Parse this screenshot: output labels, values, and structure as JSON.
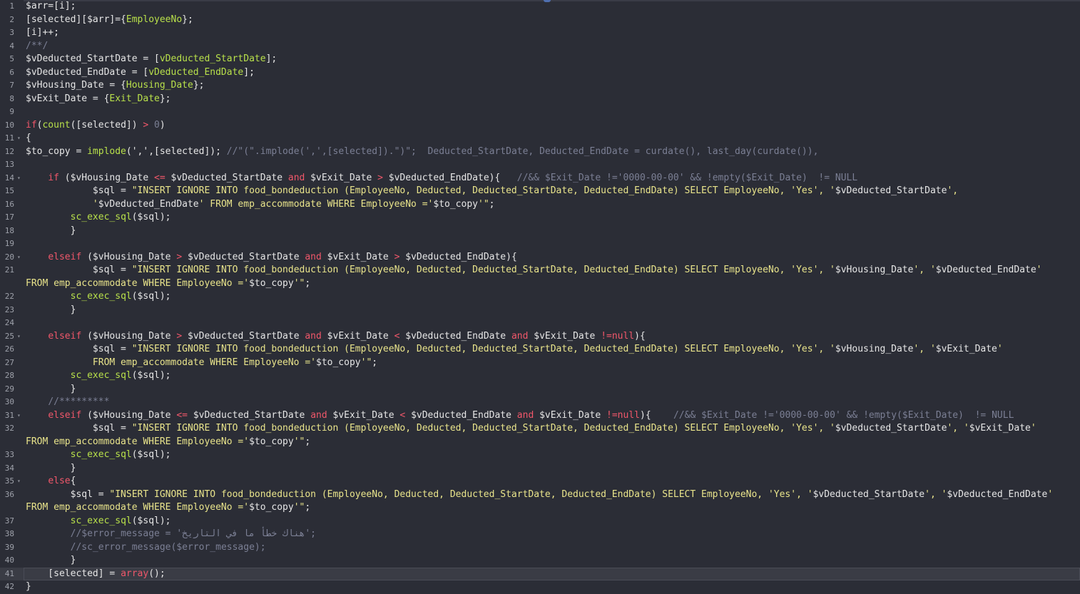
{
  "editor": {
    "lines": [
      {
        "n": "1",
        "segs": [
          [
            "v",
            "$arr="
          ],
          [
            "v",
            "[i]"
          ],
          [
            "v",
            ";"
          ]
        ]
      },
      {
        "n": "2",
        "segs": [
          [
            "v",
            "[selected][$arr]={"
          ],
          [
            "f",
            "EmployeeNo"
          ],
          [
            "v",
            "};"
          ]
        ]
      },
      {
        "n": "3",
        "segs": [
          [
            "v",
            "[i]++;"
          ]
        ]
      },
      {
        "n": "4",
        "segs": [
          [
            "c",
            "/**/"
          ]
        ]
      },
      {
        "n": "5",
        "segs": [
          [
            "v",
            "$vDeducted_StartDate = ["
          ],
          [
            "f",
            "vDeducted_StartDate"
          ],
          [
            "v",
            "];"
          ]
        ]
      },
      {
        "n": "6",
        "segs": [
          [
            "v",
            "$vDeducted_EndDate = ["
          ],
          [
            "f",
            "vDeducted_EndDate"
          ],
          [
            "v",
            "];"
          ]
        ]
      },
      {
        "n": "7",
        "segs": [
          [
            "v",
            "$vHousing_Date = {"
          ],
          [
            "f",
            "Housing_Date"
          ],
          [
            "v",
            "};"
          ]
        ]
      },
      {
        "n": "8",
        "segs": [
          [
            "v",
            "$vExit_Date = {"
          ],
          [
            "f",
            "Exit_Date"
          ],
          [
            "v",
            "};"
          ]
        ]
      },
      {
        "n": "9",
        "segs": []
      },
      {
        "n": "10",
        "segs": [
          [
            "k",
            "if"
          ],
          [
            "v",
            "("
          ],
          [
            "f",
            "count"
          ],
          [
            "v",
            "([selected]) "
          ],
          [
            "k",
            ">"
          ],
          [
            "v",
            " "
          ],
          [
            "c",
            "0"
          ],
          [
            "v",
            ")"
          ]
        ]
      },
      {
        "n": "11",
        "fold": true,
        "segs": [
          [
            "v",
            "{"
          ]
        ]
      },
      {
        "n": "12",
        "segs": [
          [
            "v",
            "$to_copy = "
          ],
          [
            "f",
            "implode"
          ],
          [
            "v",
            "(','"
          ],
          [
            "v",
            ",[selected]); "
          ],
          [
            "c",
            "//\"(\".implode(',',[selected]).\")\";  Deducted_StartDate, Deducted_EndDate = curdate(), last_day(curdate()),"
          ]
        ]
      },
      {
        "n": "13",
        "segs": []
      },
      {
        "n": "14",
        "fold": true,
        "segs": [
          [
            "v",
            "    "
          ],
          [
            "k",
            "if"
          ],
          [
            "v",
            " ($vHousing_Date "
          ],
          [
            "k",
            "<="
          ],
          [
            "v",
            " $vDeducted_StartDate "
          ],
          [
            "k",
            "and"
          ],
          [
            "v",
            " $vExit_Date "
          ],
          [
            "k",
            ">"
          ],
          [
            "v",
            " $vDeducted_EndDate){   "
          ],
          [
            "c",
            "//&& $Exit_Date !='0000-00-00' && !empty($Exit_Date)  != NULL"
          ]
        ]
      },
      {
        "n": "15",
        "segs": [
          [
            "v",
            "            $sql = "
          ],
          [
            "s",
            "\"INSERT IGNORE INTO food_bondeduction (EmployeeNo, Deducted, Deducted_StartDate, Deducted_EndDate) SELECT EmployeeNo, 'Yes', '"
          ],
          [
            "v",
            "$vDeducted_StartDate"
          ],
          [
            "s",
            "',"
          ]
        ]
      },
      {
        "n": "16",
        "segs": [
          [
            "v",
            "            "
          ],
          [
            "s",
            "'"
          ],
          [
            "v",
            "$vDeducted_EndDate"
          ],
          [
            "s",
            "' FROM emp_accommodate WHERE EmployeeNo ='"
          ],
          [
            "v",
            "$to_copy"
          ],
          [
            "s",
            "'\""
          ],
          [
            "v",
            ";"
          ]
        ]
      },
      {
        "n": "17",
        "segs": [
          [
            "v",
            "        "
          ],
          [
            "f",
            "sc_exec_sql"
          ],
          [
            "v",
            "($sql);"
          ]
        ]
      },
      {
        "n": "18",
        "segs": [
          [
            "v",
            "        }"
          ]
        ]
      },
      {
        "n": "19",
        "segs": []
      },
      {
        "n": "20",
        "fold": true,
        "segs": [
          [
            "v",
            "    "
          ],
          [
            "k",
            "elseif"
          ],
          [
            "v",
            " ($vHousing_Date "
          ],
          [
            "k",
            ">"
          ],
          [
            "v",
            " $vDeducted_StartDate "
          ],
          [
            "k",
            "and"
          ],
          [
            "v",
            " $vExit_Date "
          ],
          [
            "k",
            ">"
          ],
          [
            "v",
            " $vDeducted_EndDate){"
          ]
        ]
      },
      {
        "n": "21",
        "segs": [
          [
            "v",
            "            $sql = "
          ],
          [
            "s",
            "\"INSERT IGNORE INTO food_bondeduction (EmployeeNo, Deducted, Deducted_StartDate, Deducted_EndDate) SELECT EmployeeNo, 'Yes', '"
          ],
          [
            "v",
            "$vHousing_Date"
          ],
          [
            "s",
            "', '"
          ],
          [
            "v",
            "$vDeducted_EndDate"
          ],
          [
            "s",
            "'"
          ]
        ]
      },
      {
        "n": "",
        "segs": [
          [
            "s",
            "FROM emp_accommodate WHERE EmployeeNo ='"
          ],
          [
            "v",
            "$to_copy"
          ],
          [
            "s",
            "'\""
          ],
          [
            "v",
            ";"
          ]
        ]
      },
      {
        "n": "22",
        "segs": [
          [
            "v",
            "        "
          ],
          [
            "f",
            "sc_exec_sql"
          ],
          [
            "v",
            "($sql);"
          ]
        ]
      },
      {
        "n": "23",
        "segs": [
          [
            "v",
            "        }"
          ]
        ]
      },
      {
        "n": "24",
        "segs": []
      },
      {
        "n": "25",
        "fold": true,
        "segs": [
          [
            "v",
            "    "
          ],
          [
            "k",
            "elseif"
          ],
          [
            "v",
            " ($vHousing_Date "
          ],
          [
            "k",
            ">"
          ],
          [
            "v",
            " $vDeducted_StartDate "
          ],
          [
            "k",
            "and"
          ],
          [
            "v",
            " $vExit_Date "
          ],
          [
            "k",
            "<"
          ],
          [
            "v",
            " $vDeducted_EndDate "
          ],
          [
            "k",
            "and"
          ],
          [
            "v",
            " $vExit_Date "
          ],
          [
            "k",
            "!=null"
          ],
          [
            "v",
            "){"
          ]
        ]
      },
      {
        "n": "26",
        "segs": [
          [
            "v",
            "            $sql = "
          ],
          [
            "s",
            "\"INSERT IGNORE INTO food_bondeduction (EmployeeNo, Deducted, Deducted_StartDate, Deducted_EndDate) SELECT EmployeeNo, 'Yes', '"
          ],
          [
            "v",
            "$vHousing_Date"
          ],
          [
            "s",
            "', '"
          ],
          [
            "v",
            "$vExit_Date"
          ],
          [
            "s",
            "'"
          ]
        ]
      },
      {
        "n": "27",
        "segs": [
          [
            "s",
            "            FROM emp_accommodate WHERE EmployeeNo ='"
          ],
          [
            "v",
            "$to_copy"
          ],
          [
            "s",
            "'\""
          ],
          [
            "v",
            ";"
          ]
        ]
      },
      {
        "n": "28",
        "segs": [
          [
            "v",
            "        "
          ],
          [
            "f",
            "sc_exec_sql"
          ],
          [
            "v",
            "($sql);"
          ]
        ]
      },
      {
        "n": "29",
        "segs": [
          [
            "v",
            "        }"
          ]
        ]
      },
      {
        "n": "30",
        "segs": [
          [
            "v",
            "    "
          ],
          [
            "c",
            "//*********"
          ]
        ]
      },
      {
        "n": "31",
        "fold": true,
        "segs": [
          [
            "v",
            "    "
          ],
          [
            "k",
            "elseif"
          ],
          [
            "v",
            " ($vHousing_Date "
          ],
          [
            "k",
            "<="
          ],
          [
            "v",
            " $vDeducted_StartDate "
          ],
          [
            "k",
            "and"
          ],
          [
            "v",
            " $vExit_Date "
          ],
          [
            "k",
            "<"
          ],
          [
            "v",
            " $vDeducted_EndDate "
          ],
          [
            "k",
            "and"
          ],
          [
            "v",
            " $vExit_Date "
          ],
          [
            "k",
            "!=null"
          ],
          [
            "v",
            "){    "
          ],
          [
            "c",
            "//&& $Exit_Date !='0000-00-00' && !empty($Exit_Date)  != NULL"
          ]
        ]
      },
      {
        "n": "32",
        "segs": [
          [
            "v",
            "            $sql = "
          ],
          [
            "s",
            "\"INSERT IGNORE INTO food_bondeduction (EmployeeNo, Deducted, Deducted_StartDate, Deducted_EndDate) SELECT EmployeeNo, 'Yes', '"
          ],
          [
            "v",
            "$vDeducted_StartDate"
          ],
          [
            "s",
            "', '"
          ],
          [
            "v",
            "$vExit_Date"
          ],
          [
            "s",
            "'"
          ]
        ]
      },
      {
        "n": "",
        "segs": [
          [
            "s",
            "FROM emp_accommodate WHERE EmployeeNo ='"
          ],
          [
            "v",
            "$to_copy"
          ],
          [
            "s",
            "'\""
          ],
          [
            "v",
            ";"
          ]
        ]
      },
      {
        "n": "33",
        "segs": [
          [
            "v",
            "        "
          ],
          [
            "f",
            "sc_exec_sql"
          ],
          [
            "v",
            "($sql);"
          ]
        ]
      },
      {
        "n": "34",
        "segs": [
          [
            "v",
            "        }"
          ]
        ]
      },
      {
        "n": "35",
        "fold": true,
        "segs": [
          [
            "v",
            "    "
          ],
          [
            "k",
            "else"
          ],
          [
            "v",
            "{"
          ]
        ]
      },
      {
        "n": "36",
        "segs": [
          [
            "v",
            "        $sql = "
          ],
          [
            "s",
            "\"INSERT IGNORE INTO food_bondeduction (EmployeeNo, Deducted, Deducted_StartDate, Deducted_EndDate) SELECT EmployeeNo, 'Yes', '"
          ],
          [
            "v",
            "$vDeducted_StartDate"
          ],
          [
            "s",
            "', '"
          ],
          [
            "v",
            "$vDeducted_EndDate"
          ],
          [
            "s",
            "'"
          ]
        ]
      },
      {
        "n": "",
        "segs": [
          [
            "s",
            "FROM emp_accommodate WHERE EmployeeNo ='"
          ],
          [
            "v",
            "$to_copy"
          ],
          [
            "s",
            "'\""
          ],
          [
            "v",
            ";"
          ]
        ]
      },
      {
        "n": "37",
        "segs": [
          [
            "v",
            "        "
          ],
          [
            "f",
            "sc_exec_sql"
          ],
          [
            "v",
            "($sql);"
          ]
        ]
      },
      {
        "n": "38",
        "segs": [
          [
            "v",
            "        "
          ],
          [
            "c",
            "//$error_message = 'هناك خطأ ما في التاريخ';"
          ]
        ]
      },
      {
        "n": "39",
        "segs": [
          [
            "v",
            "        "
          ],
          [
            "c",
            "//sc_error_message($error_message);"
          ]
        ]
      },
      {
        "n": "40",
        "segs": [
          [
            "v",
            "        }"
          ]
        ]
      },
      {
        "n": "41",
        "active": true,
        "segs": [
          [
            "v",
            "    [selected] = "
          ],
          [
            "k",
            "array"
          ],
          [
            "v",
            "();"
          ]
        ]
      },
      {
        "n": "42",
        "segs": [
          [
            "v",
            "}"
          ]
        ]
      }
    ]
  }
}
